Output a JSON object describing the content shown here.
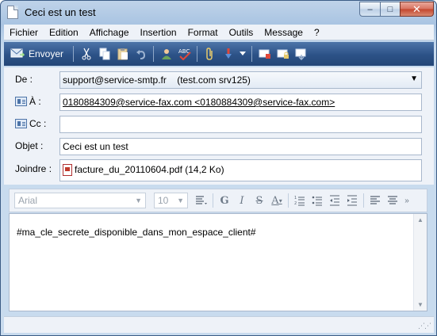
{
  "window": {
    "title": "Ceci est un test",
    "min_symbol": "–",
    "max_symbol": "□",
    "close_symbol": "✕"
  },
  "menu": [
    "Fichier",
    "Edition",
    "Affichage",
    "Insertion",
    "Format",
    "Outils",
    "Message",
    "?"
  ],
  "toolbar": {
    "send_label": "Envoyer",
    "buttons": [
      "cut-icon",
      "copy-icon",
      "paste-icon",
      "undo-icon",
      "address-book-icon",
      "spellcheck-icon",
      "attach-icon",
      "priority-icon",
      "dropdown-icon",
      "sign-icon",
      "encrypt-icon",
      "offline-icon"
    ]
  },
  "form": {
    "from_label": "De :",
    "from_value": "support@service-smtp.fr    (test.com srv125)",
    "to_label": "À :",
    "to_value": "0180884309@service-fax.com <0180884309@service-fax.com>",
    "cc_label": "Cc :",
    "cc_value": "",
    "subject_label": "Objet :",
    "subject_value": "Ceci est un test",
    "attach_label": "Joindre :",
    "attachment": "facture_du_20110604.pdf (14,2 Ko)"
  },
  "editor_toolbar": {
    "font": "Arial",
    "size": "10",
    "buttons": [
      "paragraph-style-icon",
      "bold-icon",
      "italic-icon",
      "underline-icon",
      "font-color-icon",
      "numbered-list-icon",
      "bullet-list-icon",
      "decrease-indent-icon",
      "increase-indent-icon",
      "align-left-icon",
      "align-center-icon",
      "more-icon"
    ]
  },
  "editor": {
    "body": "#ma_cle_secrete_disponible_dans_mon_espace_client#"
  }
}
